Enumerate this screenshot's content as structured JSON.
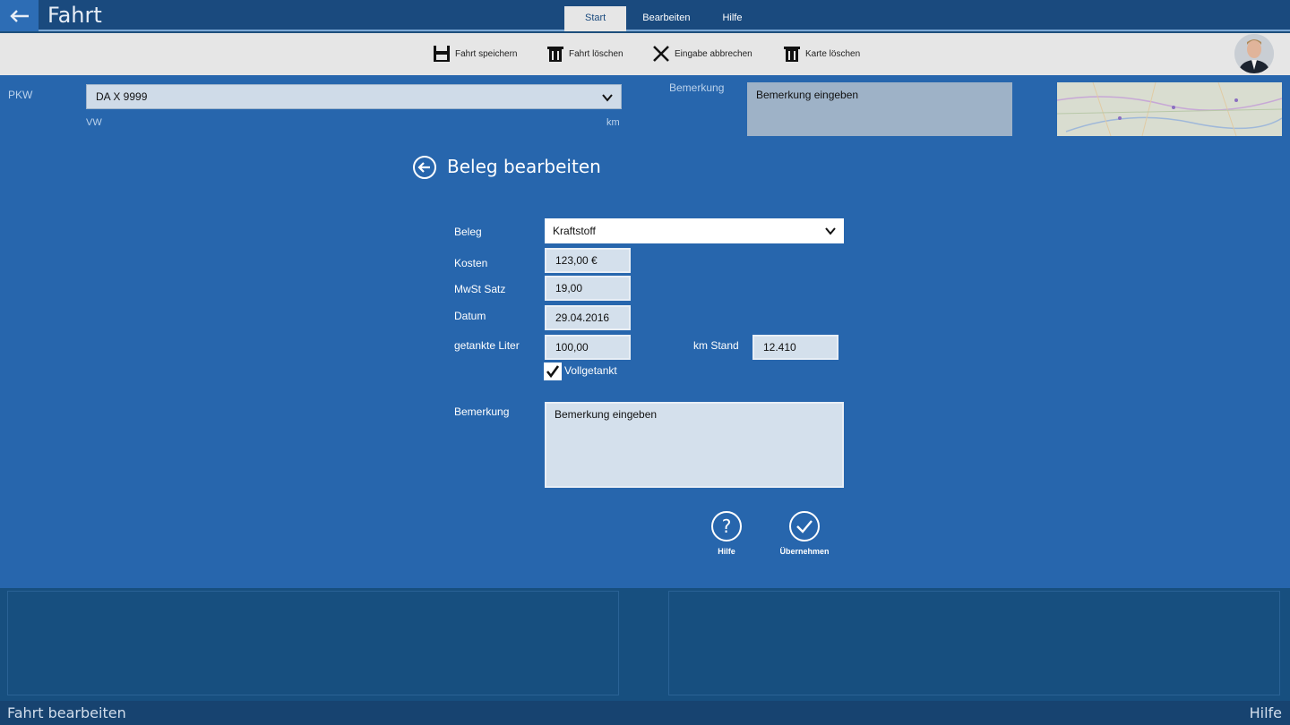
{
  "app": {
    "title": "Fahrt",
    "tabs": [
      {
        "label": "Start",
        "active": true
      },
      {
        "label": "Bearbeiten",
        "active": false
      },
      {
        "label": "Hilfe",
        "active": false
      }
    ]
  },
  "ribbon": {
    "save_label": "Fahrt speichern",
    "delete_label": "Fahrt löschen",
    "cancel_label": "Eingabe abbrechen",
    "map_delete_label": "Karte löschen"
  },
  "header": {
    "pkw_label": "PKW",
    "pkw_value": "DA X 9999",
    "pkw_make": "VW",
    "pkw_unit": "km",
    "remark_label": "Bemerkung",
    "remark_placeholder": "Bemerkung eingeben"
  },
  "dialog": {
    "title": "Beleg bearbeiten",
    "fields": {
      "beleg_label": "Beleg",
      "beleg_value": "Kraftstoff",
      "kosten_label": "Kosten",
      "kosten_value": "123,00 €",
      "mwst_label": "MwSt Satz",
      "mwst_value": "19,00",
      "datum_label": "Datum",
      "datum_value": "29.04.2016",
      "liter_label": "getankte Liter",
      "liter_value": "100,00",
      "kmstand_label": "km Stand",
      "kmstand_value": "12.410",
      "voll_label": "Vollgetankt",
      "voll_checked": true,
      "bem_label": "Bemerkung",
      "bem_placeholder": "Bemerkung eingeben"
    },
    "help_label": "Hilfe",
    "apply_label": "Übernehmen"
  },
  "status": {
    "left": "Fahrt bearbeiten",
    "right": "Hilfe"
  },
  "colors": {
    "title_bar": "#1a4a7e",
    "accent": "#2766ad",
    "ribbon": "#e6e6e6",
    "bottom_panel": "#174f7f",
    "status_bar": "#174370"
  }
}
